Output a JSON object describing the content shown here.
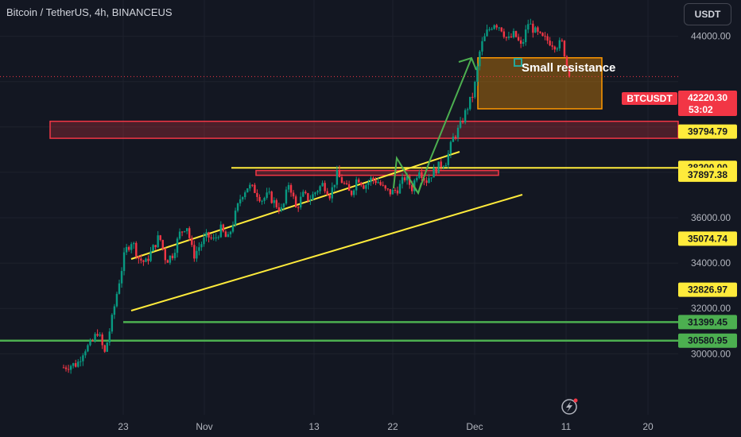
{
  "header": {
    "symbol_title": "Bitcoin / TetherUS, 4h, BINANCEUS",
    "currency_button": "USDT"
  },
  "annotation": "Small resistance",
  "last_price": {
    "symbol": "BTCUSDT",
    "value": "42220.30",
    "countdown": "53:02",
    "color": "#f23645"
  },
  "colors": {
    "up": "#089981",
    "down": "#f23645",
    "yellow": "#ffeb3b",
    "green": "#4caf50",
    "orange": "#ff9800",
    "red": "#f23645"
  },
  "chart_data": {
    "type": "candlestick",
    "y_axis": {
      "ticks": [
        "44000.00",
        "36000.00",
        "34000.00",
        "32000.00",
        "30000.00"
      ],
      "ylim": [
        29100,
        46600
      ]
    },
    "x_axis": {
      "ticks": [
        "23",
        "Nov",
        "13",
        "22",
        "Dec",
        "11",
        "20"
      ]
    },
    "price_path": [
      [
        29400,
        29500
      ],
      [
        29550,
        30200
      ],
      [
        30400,
        31000
      ],
      [
        30000,
        31400
      ],
      [
        33000,
        34500
      ],
      [
        35000,
        34200
      ],
      [
        34000,
        34600
      ],
      [
        35200,
        34100
      ],
      [
        34400,
        35300
      ],
      [
        35700,
        34300
      ],
      [
        34800,
        35200
      ],
      [
        35000,
        35500
      ],
      [
        35000,
        36000
      ],
      [
        37000,
        37400
      ],
      [
        37200,
        36800
      ],
      [
        37000,
        36600
      ],
      [
        36300,
        37600
      ],
      [
        36400,
        37000
      ],
      [
        36800,
        37200
      ],
      [
        37500,
        37000
      ],
      [
        37900,
        37500
      ],
      [
        37000,
        37800
      ],
      [
        37400,
        37700
      ],
      [
        37600,
        37200
      ],
      [
        37100,
        37300
      ],
      [
        37800,
        37300
      ],
      [
        38200,
        37600
      ],
      [
        38000,
        38300
      ],
      [
        38500,
        39500
      ],
      [
        40000,
        40800
      ],
      [
        41500,
        43500
      ],
      [
        44200,
        44600
      ],
      [
        44400,
        43800
      ],
      [
        44100,
        43500
      ],
      [
        44600,
        44200
      ],
      [
        43900,
        43800
      ],
      [
        43600,
        43700
      ],
      [
        42220
      ]
    ],
    "horizontal_levels": [
      {
        "price": "39794.79",
        "value": 39794.79,
        "tag_color": "#ffeb3b",
        "line": "none"
      },
      {
        "price": "38200.00",
        "value": 38200.0,
        "tag_color": "#ffeb3b",
        "line": "yellow"
      },
      {
        "price": "37897.38",
        "value": 37897.38,
        "tag_color": "#ffeb3b",
        "line": "none"
      },
      {
        "price": "35074.74",
        "value": 35074.74,
        "tag_color": "#ffeb3b",
        "line": "none"
      },
      {
        "price": "32826.97",
        "value": 32826.97,
        "tag_color": "#ffeb3b",
        "line": "none"
      },
      {
        "price": "31399.45",
        "value": 31399.45,
        "tag_color": "#4caf50",
        "line": "green"
      },
      {
        "price": "30580.95",
        "value": 30580.95,
        "tag_color": "#4caf50",
        "line": "green"
      }
    ],
    "zones": [
      {
        "label": "red-resistance-zone",
        "price_low": 39500,
        "price_high": 40250
      },
      {
        "label": "orange-zone",
        "price_low": 40800,
        "price_high": 43050
      },
      {
        "label": "red-small-zone",
        "price_low": 37870,
        "price_high": 38080
      }
    ]
  }
}
